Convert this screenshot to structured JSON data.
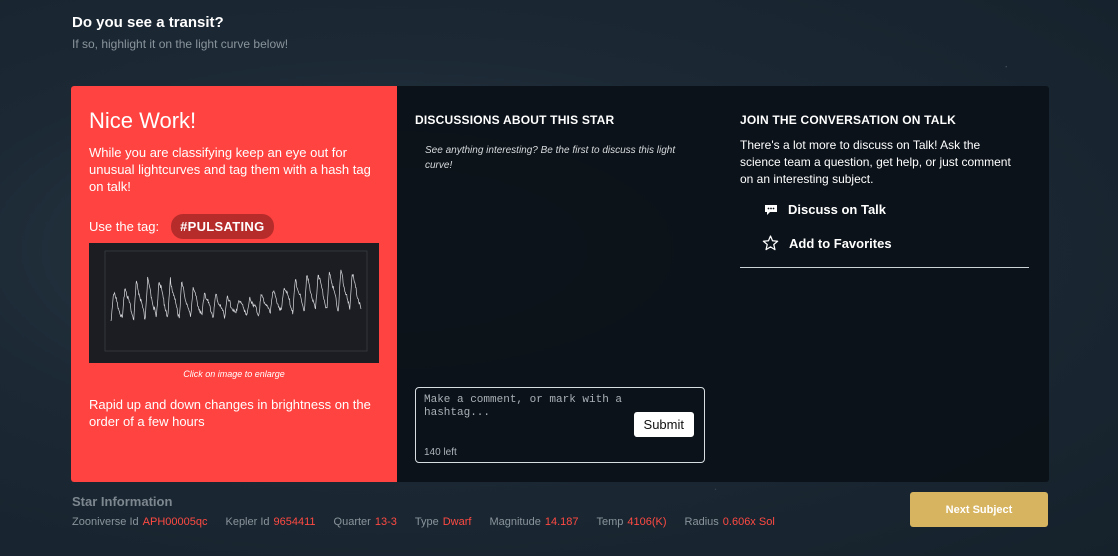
{
  "header": {
    "title": "Do you see a transit?",
    "subtitle": "If so, highlight it on the light curve below!"
  },
  "feedback": {
    "heading": "Nice Work!",
    "description": "While you are classifying keep an eye out for unusual lightcurves and tag them with a hash tag on talk!",
    "use_tag_label": "Use the tag:",
    "tag": "#PULSATING",
    "image_caption": "Click on image to enlarge",
    "summary": "Rapid up and down changes in brightness on the order of a few hours"
  },
  "discussions": {
    "heading": "DISCUSSIONS ABOUT THIS STAR",
    "empty_text": "See anything interesting? Be the first to discuss this light curve!",
    "comment_placeholder": "Make a comment, or mark with a hashtag...",
    "submit_label": "Submit",
    "chars_left": "140 left"
  },
  "join": {
    "heading": "JOIN THE CONVERSATION ON TALK",
    "text": "There's a lot more to discuss on Talk! Ask the science team a question, get help, or just comment on an interesting subject.",
    "discuss_label": "Discuss on Talk",
    "discuss_icon": "chat-bubble-icon",
    "favorite_label": "Add to Favorites",
    "favorite_icon": "star-outline-icon"
  },
  "star_info": {
    "heading": "Star Information",
    "fields": [
      {
        "label": "Zooniverse Id",
        "value": "APH00005qc"
      },
      {
        "label": "Kepler Id",
        "value": "9654411"
      },
      {
        "label": "Quarter",
        "value": "13-3"
      },
      {
        "label": "Type",
        "value": "Dwarf"
      },
      {
        "label": "Magnitude",
        "value": "14.187"
      },
      {
        "label": "Temp",
        "value": "4106(K)"
      },
      {
        "label": "Radius",
        "value": "0.606x Sol"
      }
    ]
  },
  "next_label": "Next Subject",
  "colors": {
    "accent_red": "#ff4340",
    "tag_bg": "#b62c2b",
    "next_button": "#d7b45f",
    "value_red": "#ff4a42"
  }
}
